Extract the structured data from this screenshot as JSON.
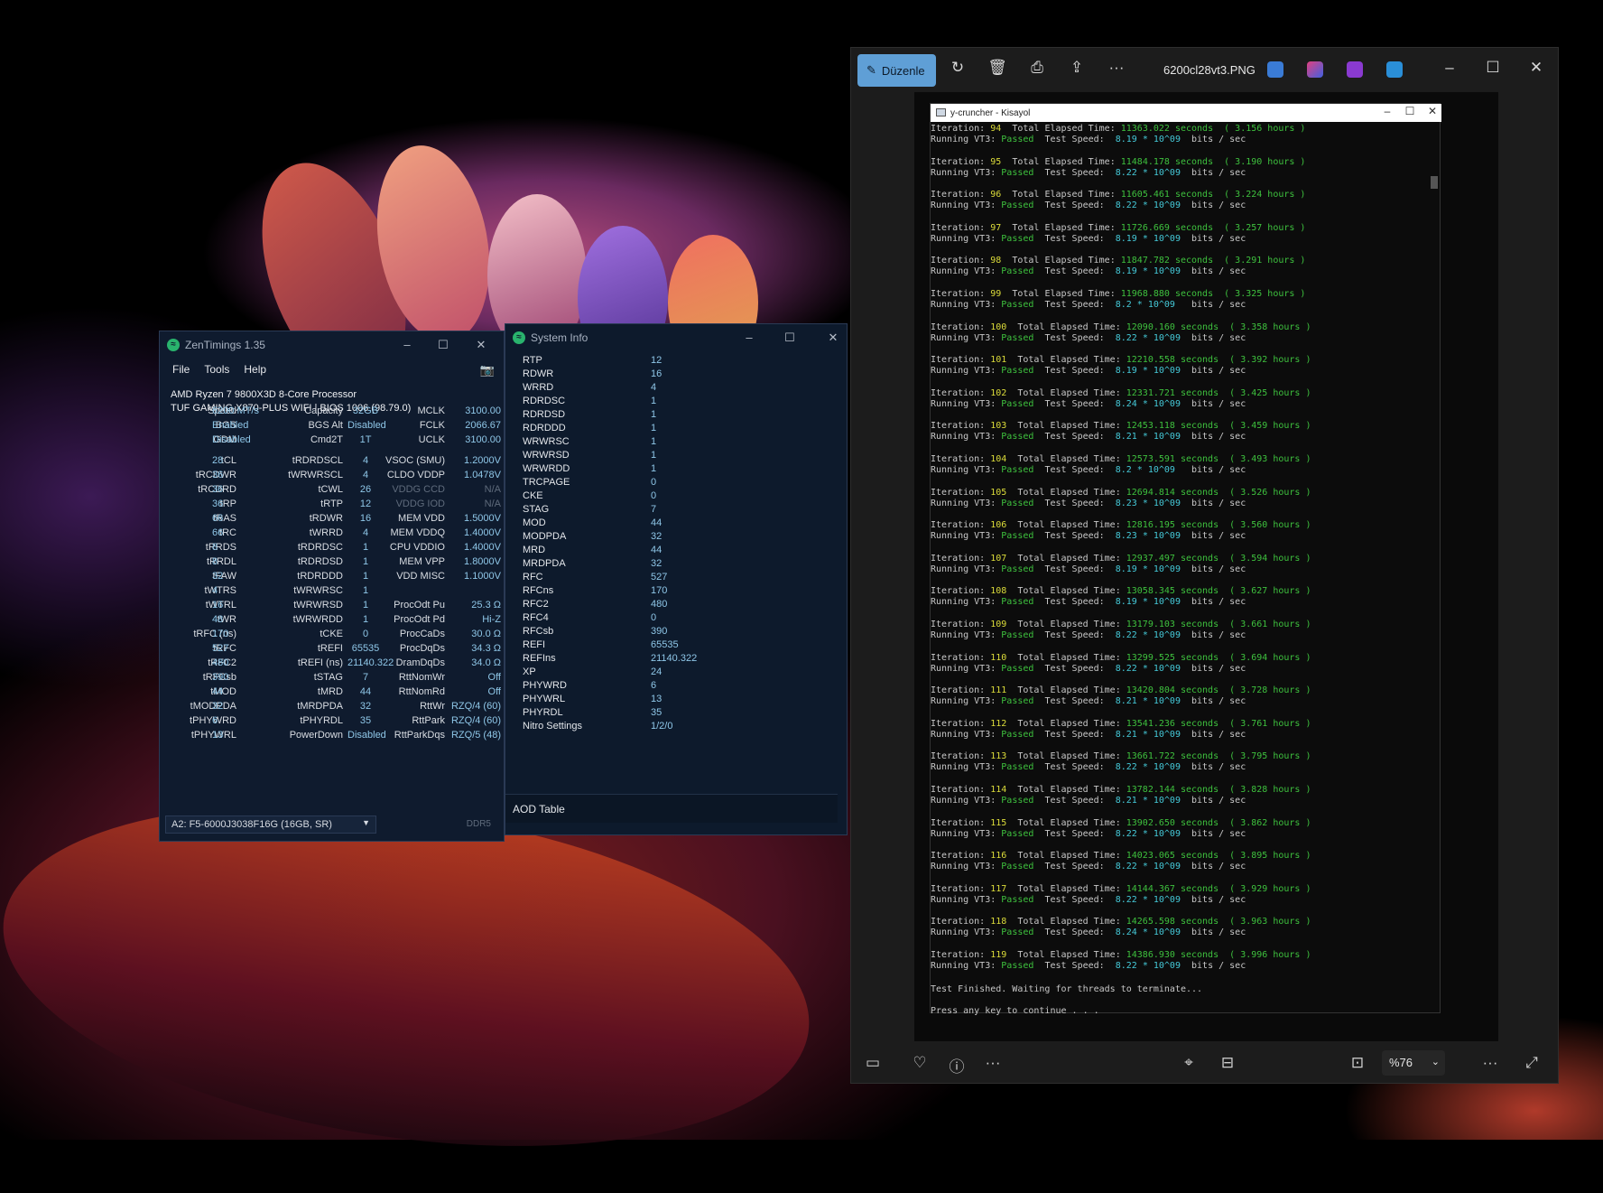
{
  "colors": {
    "accent": "#5f9fd6",
    "passed": "#3ec13e",
    "number": "#dcdc3a",
    "cyan": "#45c9d8",
    "value": "#8fc7e8"
  },
  "zentimings": {
    "title": "ZenTimings 1.35",
    "menu": [
      "File",
      "Tools",
      "Help"
    ],
    "cpu": "AMD Ryzen 7 9800X3D 8-Core Processor",
    "board": "TUF GAMING X870-PLUS WIFI | BIOS 1006 (98.79.0)",
    "header_rows": [
      [
        "Speed",
        "6200 MT/s",
        "Capacity",
        "32GB",
        "MCLK",
        "3100.00"
      ],
      [
        "BGS",
        "Enabled",
        "BGS Alt",
        "Disabled",
        "FCLK",
        "2066.67"
      ],
      [
        "GDM",
        "Disabled",
        "Cmd2T",
        "1T",
        "UCLK",
        "3100.00"
      ]
    ],
    "rows": [
      [
        "tCL",
        "28",
        "tRDRDSCL",
        "4",
        "VSOC (SMU)",
        "1.2000V"
      ],
      [
        "tRCDWR",
        "36",
        "tWRWRSCL",
        "4",
        "CLDO VDDP",
        "1.0478V"
      ],
      [
        "tRCDRD",
        "36",
        "tCWL",
        "26",
        "VDDG CCD",
        "N/A"
      ],
      [
        "tRP",
        "36",
        "tRTP",
        "12",
        "VDDG IOD",
        "N/A"
      ],
      [
        "tRAS",
        "66",
        "tRDWR",
        "16",
        "MEM VDD",
        "1.5000V"
      ],
      [
        "tRC",
        "66",
        "tWRRD",
        "4",
        "MEM VDDQ",
        "1.4000V"
      ],
      [
        "tRRDS",
        "8",
        "tRDRDSC",
        "1",
        "CPU VDDIO",
        "1.4000V"
      ],
      [
        "tRRDL",
        "8",
        "tRDRDSD",
        "1",
        "MEM VPP",
        "1.8000V"
      ],
      [
        "tFAW",
        "32",
        "tRDRDDD",
        "1",
        "VDD MISC",
        "1.1000V"
      ],
      [
        "tWTRS",
        "4",
        "tWRWRSC",
        "1",
        "",
        ""
      ],
      [
        "tWTRL",
        "16",
        "tWRWRSD",
        "1",
        "ProcOdt Pu",
        "25.3 Ω"
      ],
      [
        "tWR",
        "48",
        "tWRWRDD",
        "1",
        "ProcOdt Pd",
        "Hi-Z"
      ],
      [
        "tRFC (ns)",
        "170",
        "tCKE",
        "0",
        "ProcCaDs",
        "30.0 Ω"
      ],
      [
        "tRFC",
        "527",
        "tREFI",
        "65535",
        "ProcDqDs",
        "34.3 Ω"
      ],
      [
        "tRFC2",
        "480",
        "tREFI (ns)",
        "21140.322",
        "DramDqDs",
        "34.0 Ω"
      ],
      [
        "tRFCsb",
        "390",
        "tSTAG",
        "7",
        "RttNomWr",
        "Off"
      ],
      [
        "tMOD",
        "44",
        "tMRD",
        "44",
        "RttNomRd",
        "Off"
      ],
      [
        "tMODPDA",
        "32",
        "tMRDPDA",
        "32",
        "RttWr",
        "RZQ/4 (60)"
      ],
      [
        "tPHYWRD",
        "6",
        "tPHYRDL",
        "35",
        "RttPark",
        "RZQ/4 (60)"
      ],
      [
        "tPHYWRL",
        "13",
        "PowerDown",
        "Disabled",
        "RttParkDqs",
        "RZQ/5 (48)"
      ]
    ],
    "dimm": "A2: F5-6000J3038F16G (16GB, SR)",
    "memtype": "DDR5"
  },
  "sysinfo": {
    "title": "System Info",
    "rows": [
      [
        "RTP",
        "12"
      ],
      [
        "RDWR",
        "16"
      ],
      [
        "WRRD",
        "4"
      ],
      [
        "RDRDSC",
        "1"
      ],
      [
        "RDRDSD",
        "1"
      ],
      [
        "RDRDDD",
        "1"
      ],
      [
        "WRWRSC",
        "1"
      ],
      [
        "WRWRSD",
        "1"
      ],
      [
        "WRWRDD",
        "1"
      ],
      [
        "TRCPAGE",
        "0"
      ],
      [
        "CKE",
        "0"
      ],
      [
        "STAG",
        "7"
      ],
      [
        "MOD",
        "44"
      ],
      [
        "MODPDA",
        "32"
      ],
      [
        "MRD",
        "44"
      ],
      [
        "MRDPDA",
        "32"
      ],
      [
        "RFC",
        "527"
      ],
      [
        "RFCns",
        "170"
      ],
      [
        "RFC2",
        "480"
      ],
      [
        "RFC4",
        "0"
      ],
      [
        "RFCsb",
        "390"
      ],
      [
        "REFI",
        "65535"
      ],
      [
        "REFIns",
        "21140.322"
      ],
      [
        "XP",
        "24"
      ],
      [
        "PHYWRD",
        "6"
      ],
      [
        "PHYWRL",
        "13"
      ],
      [
        "PHYRDL",
        "35"
      ],
      [
        "Nitro Settings",
        "1/2/0"
      ]
    ],
    "aod": "AOD Table"
  },
  "photos": {
    "edit_label": "Düzenle",
    "filename": "6200cl28vt3.PNG",
    "zoom": "%76"
  },
  "console": {
    "title": "y-cruncher - Kisayol",
    "iterations": [
      [
        "94",
        "11363.022",
        "3.156",
        "8.19 * 10^09"
      ],
      [
        "95",
        "11484.178",
        "3.190",
        "8.22 * 10^09"
      ],
      [
        "96",
        "11605.461",
        "3.224",
        "8.22 * 10^09"
      ],
      [
        "97",
        "11726.669",
        "3.257",
        "8.19 * 10^09"
      ],
      [
        "98",
        "11847.782",
        "3.291",
        "8.19 * 10^09"
      ],
      [
        "99",
        "11968.880",
        "3.325",
        "8.2 * 10^09 "
      ],
      [
        "100",
        "12090.160",
        "3.358",
        "8.22 * 10^09"
      ],
      [
        "101",
        "12210.558",
        "3.392",
        "8.19 * 10^09"
      ],
      [
        "102",
        "12331.721",
        "3.425",
        "8.24 * 10^09"
      ],
      [
        "103",
        "12453.118",
        "3.459",
        "8.21 * 10^09"
      ],
      [
        "104",
        "12573.591",
        "3.493",
        "8.2 * 10^09 "
      ],
      [
        "105",
        "12694.814",
        "3.526",
        "8.23 * 10^09"
      ],
      [
        "106",
        "12816.195",
        "3.560",
        "8.23 * 10^09"
      ],
      [
        "107",
        "12937.497",
        "3.594",
        "8.19 * 10^09"
      ],
      [
        "108",
        "13058.345",
        "3.627",
        "8.19 * 10^09"
      ],
      [
        "109",
        "13179.103",
        "3.661",
        "8.22 * 10^09"
      ],
      [
        "110",
        "13299.525",
        "3.694",
        "8.22 * 10^09"
      ],
      [
        "111",
        "13420.804",
        "3.728",
        "8.21 * 10^09"
      ],
      [
        "112",
        "13541.236",
        "3.761",
        "8.21 * 10^09"
      ],
      [
        "113",
        "13661.722",
        "3.795",
        "8.22 * 10^09"
      ],
      [
        "114",
        "13782.144",
        "3.828",
        "8.21 * 10^09"
      ],
      [
        "115",
        "13902.650",
        "3.862",
        "8.22 * 10^09"
      ],
      [
        "116",
        "14023.065",
        "3.895",
        "8.22 * 10^09"
      ],
      [
        "117",
        "14144.367",
        "3.929",
        "8.22 * 10^09"
      ],
      [
        "118",
        "14265.598",
        "3.963",
        "8.24 * 10^09"
      ],
      [
        "119",
        "14386.930",
        "3.996",
        "8.22 * 10^09"
      ]
    ],
    "finished": "Test Finished. Waiting for threads to terminate...",
    "press": "Press any key to continue . . ."
  }
}
